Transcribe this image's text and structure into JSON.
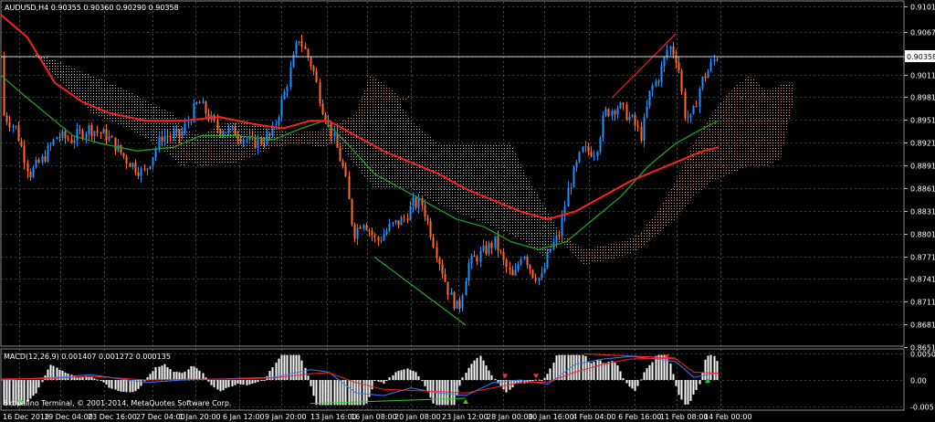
{
  "header": {
    "symbol_line": "AUDUSD,H4  0.90355 0.90360 0.90290 0.90358",
    "macd_line": "MACD(12,26,9) 0.001407 0.001272 0.000135",
    "copyright": "Skopalino Terminal, © 2001-2014, MetaQuotes Software Corp."
  },
  "colors": {
    "background": "#000000",
    "grid": "#6f7f6f",
    "bull_candle": "#1e90ff",
    "bear_candle": "#ff6a2a",
    "ma_red": "#ff2020",
    "ma_green": "#1f9f1f",
    "cloud_gray": "#c8c8c8",
    "cloud_orange": "#f0a070",
    "macd_blue": "#3a7bff",
    "macd_red": "#ff2020",
    "trend_green": "#2ecc2e",
    "trend_red": "#ff3030"
  },
  "chart_data": [
    {
      "type": "candlestick",
      "symbol": "AUDUSD",
      "timeframe": "H4",
      "ohlc_current": {
        "open": 0.90355,
        "high": 0.9036,
        "low": 0.9029,
        "close": 0.90358
      },
      "current_price_label": "0.90358",
      "ylim": [
        0.864,
        0.912
      ],
      "y_ticks": [
        "0.91010",
        "0.90670",
        "0.90350",
        "0.90110",
        "0.89810",
        "0.89510",
        "0.89210",
        "0.88910",
        "0.88610",
        "0.88310",
        "0.88010",
        "0.87710",
        "0.87410",
        "0.87110",
        "0.86810",
        "0.86510"
      ],
      "x_ticks": [
        "16 Dec 2013",
        "19 Dec 04:00",
        "23 Dec 16:00",
        "27 Dec 04:00",
        "1 Jan 20:00",
        "6 Jan 12:00",
        "9 Jan 20:00",
        "13 Jan 16:00",
        "16 Jan 08:00",
        "20 Jan 08:00",
        "23 Jan 12:00",
        "28 Jan 00:00",
        "30 Jan 16:00",
        "4 Feb 04:00",
        "6 Feb 16:00",
        "11 Feb 08:00",
        "14 Feb 00:00"
      ],
      "indicators": [
        "moving average (red)",
        "moving average (green)",
        "ichimoku cloud"
      ],
      "grid": true
    },
    {
      "type": "macd",
      "name": "MACD(12,26,9)",
      "values": {
        "main": 0.001407,
        "signal": 0.001272,
        "histogram": 0.000135
      },
      "y_ticks": [
        "0.005046",
        "0.00",
        "-0.005162"
      ],
      "ylim": [
        -0.0056,
        0.0056
      ]
    }
  ]
}
